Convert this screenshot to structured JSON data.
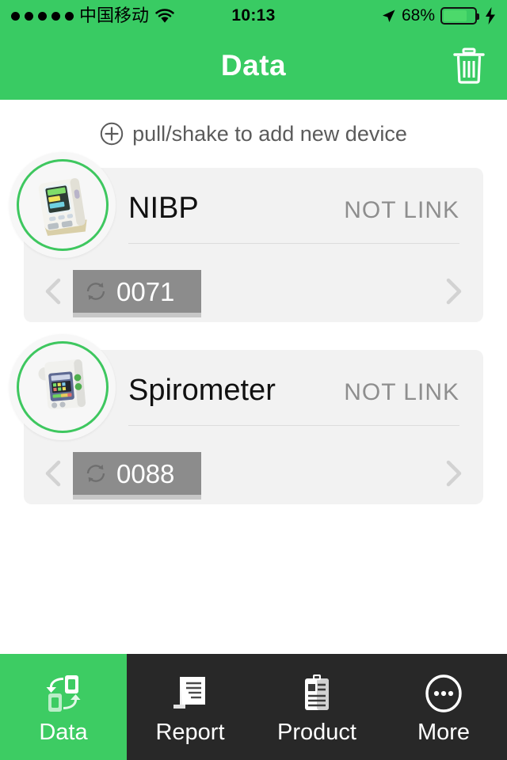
{
  "status_bar": {
    "carrier": "中国移动",
    "signal_dots": 5,
    "wifi_icon": "wifi-icon",
    "time": "10:13",
    "location_icon": "location-arrow-icon",
    "battery_percent": "68%",
    "battery_level": 68,
    "charging_icon": "lightning-bolt-icon"
  },
  "nav": {
    "title": "Data",
    "trash_icon": "trash-icon"
  },
  "hint": {
    "plus_icon": "plus-circle-icon",
    "label": "pull/shake to add new device"
  },
  "devices": [
    {
      "name": "NIBP",
      "status": "NOT LINK",
      "device_id": "0071",
      "avatar_icon": "blood-pressure-monitor-icon",
      "sync_icon": "sync-refresh-icon",
      "prev_icon": "chevron-left-icon",
      "next_icon": "chevron-right-icon"
    },
    {
      "name": "Spirometer",
      "status": "NOT LINK",
      "device_id": "0088",
      "avatar_icon": "spirometer-icon",
      "sync_icon": "sync-refresh-icon",
      "prev_icon": "chevron-left-icon",
      "next_icon": "chevron-right-icon"
    }
  ],
  "tabs": [
    {
      "label": "Data",
      "icon": "data-sync-icon",
      "active": true
    },
    {
      "label": "Report",
      "icon": "document-icon",
      "active": false
    },
    {
      "label": "Product",
      "icon": "clipboard-icon",
      "active": false
    },
    {
      "label": "More",
      "icon": "ellipsis-circle-icon",
      "active": false
    }
  ],
  "colors": {
    "brand_green": "#39cb63",
    "tab_active_green": "#3dcc63",
    "tab_bar_dark": "#282828",
    "card_bg": "#f2f2f2",
    "tag_gray": "#8c8c8c",
    "status_gray": "#8e8e8e"
  }
}
